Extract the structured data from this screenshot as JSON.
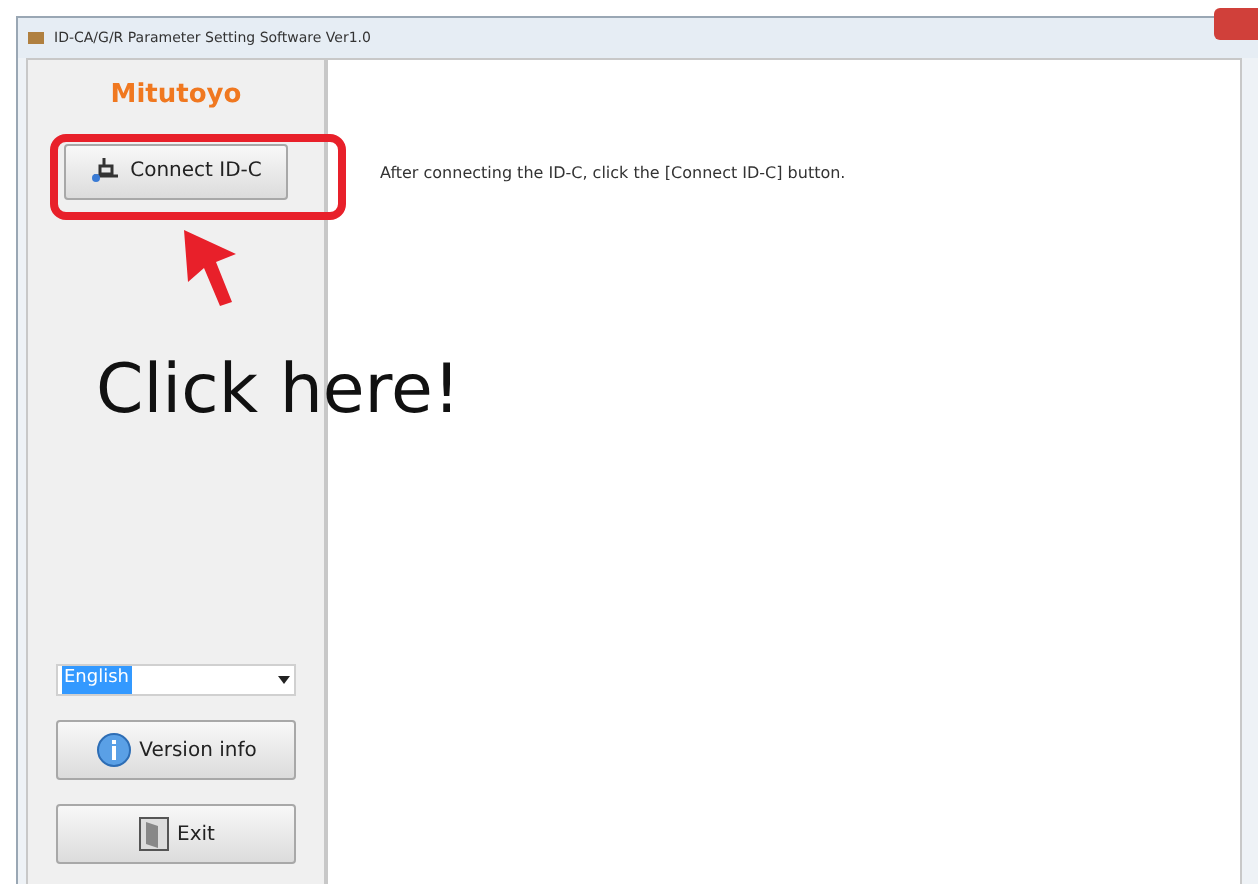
{
  "window": {
    "title": "ID-CA/G/R Parameter Setting Software  Ver1.0"
  },
  "sidebar": {
    "logo": "Mitutoyo",
    "connect_button": "Connect ID-C",
    "language": {
      "value": "English"
    },
    "version_button": "Version info",
    "exit_button": "Exit"
  },
  "content": {
    "instruction": "After connecting the ID-C, click the [Connect ID-C] button."
  },
  "annotation": {
    "text": "Click here!"
  }
}
